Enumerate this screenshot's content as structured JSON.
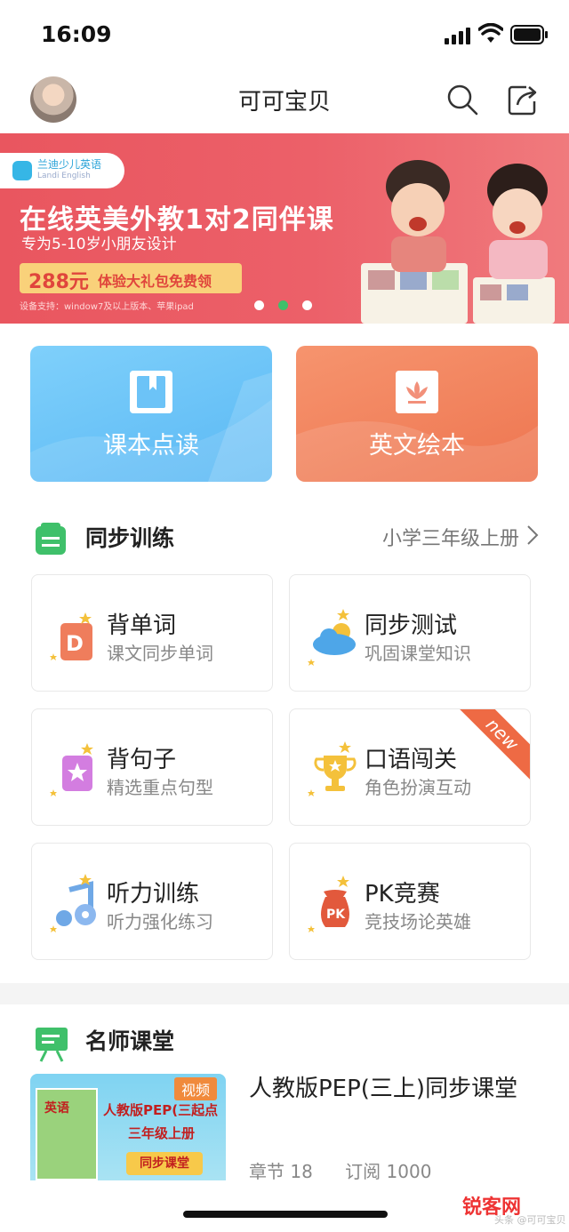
{
  "status_bar": {
    "time": "16:09"
  },
  "nav": {
    "title": "可可宝贝"
  },
  "banner": {
    "brand": "兰迪少儿英语",
    "brand_sub": "Landi English",
    "headline": "在线英美外教1对2同伴课",
    "subline": "专为5-10岁小朋友设计",
    "price": "288元",
    "offer": "体验大礼包免费领",
    "note": "设备支持：window7及以上版本、苹果ipad"
  },
  "features": [
    {
      "label": "课本点读",
      "icon": "book-icon",
      "color": "#5ab8f4"
    },
    {
      "label": "英文绘本",
      "icon": "flower-icon",
      "color": "#ee7550"
    }
  ],
  "sync_section": {
    "title": "同步训练",
    "grade": "小学三年级上册",
    "items": [
      {
        "title": "背单词",
        "subtitle": "课文同步单词",
        "icon": "word-card-icon"
      },
      {
        "title": "同步测试",
        "subtitle": "巩固课堂知识",
        "icon": "cloud-icon"
      },
      {
        "title": "背句子",
        "subtitle": "精选重点句型",
        "icon": "star-book-icon"
      },
      {
        "title": "口语闯关",
        "subtitle": "角色扮演互动",
        "icon": "trophy-icon",
        "badge": "new"
      },
      {
        "title": "听力训练",
        "subtitle": "听力强化练习",
        "icon": "music-note-icon"
      },
      {
        "title": "PK竞赛",
        "subtitle": "竞技场论英雄",
        "icon": "pk-bag-icon"
      }
    ]
  },
  "teacher_section": {
    "title": "名师课堂",
    "course": {
      "thumb_tag": "视频",
      "thumb_line1": "人教版PEP(三起点",
      "thumb_line2": "三年级上册",
      "thumb_pill": "同步课堂",
      "thumb_book": "英语",
      "title": "人教版PEP(三上)同步课堂",
      "chapters": "章节 18",
      "subscriptions": "订阅 1000"
    }
  },
  "watermark": {
    "text": "锐客网",
    "sub": "头条 @可可宝贝"
  },
  "colors": {
    "accent_green": "#3fc06a",
    "banner_red": "#e9565f",
    "new_badge": "#ee6a44"
  }
}
